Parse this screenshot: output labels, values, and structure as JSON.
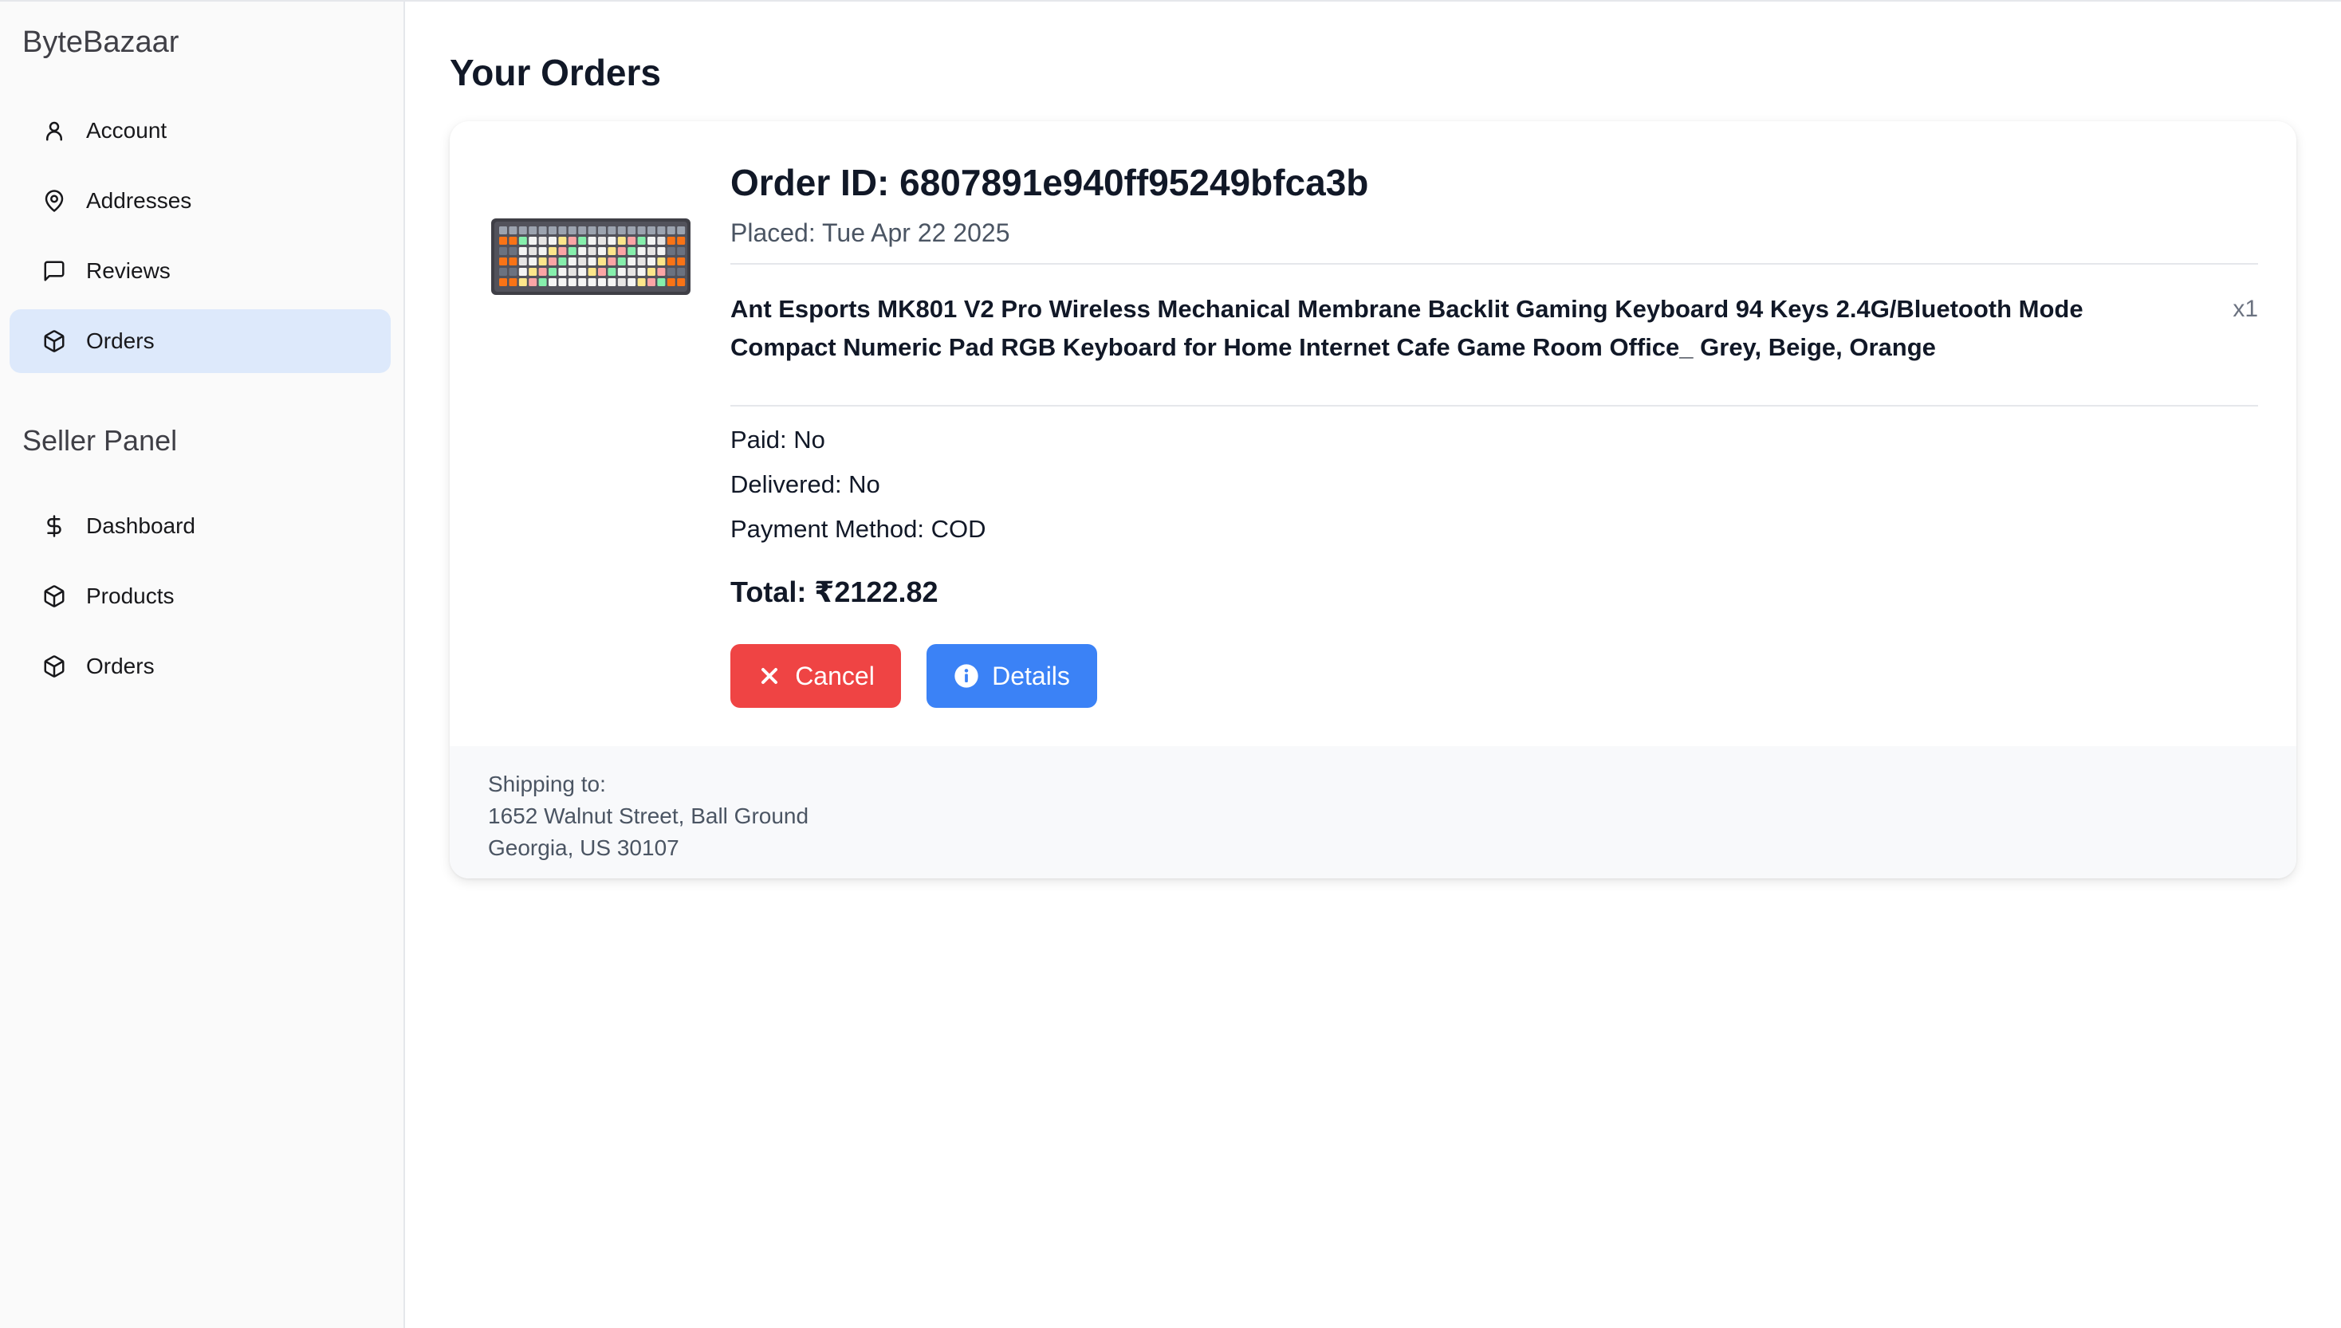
{
  "brand": "ByteBazaar",
  "sidebar": {
    "user_items": [
      {
        "label": "Account",
        "icon": "user-icon"
      },
      {
        "label": "Addresses",
        "icon": "map-pin-icon"
      },
      {
        "label": "Reviews",
        "icon": "message-square-icon"
      },
      {
        "label": "Orders",
        "icon": "package-icon",
        "active": true
      }
    ],
    "seller_title": "Seller Panel",
    "seller_items": [
      {
        "label": "Dashboard",
        "icon": "dollar-sign-icon"
      },
      {
        "label": "Products",
        "icon": "package-icon"
      },
      {
        "label": "Orders",
        "icon": "package-icon"
      }
    ]
  },
  "main": {
    "title": "Your Orders",
    "order": {
      "order_id": "Order ID: 6807891e940ff95249bfca3b",
      "placed": "Placed: Tue Apr 22 2025",
      "item": {
        "name": "Ant Esports MK801 V2 Pro Wireless Mechanical Membrane Backlit Gaming Keyboard 94 Keys 2.4G/Bluetooth Mode Compact Numeric Pad RGB Keyboard for Home Internet Cafe Game Room Office_ Grey, Beige, Orange",
        "qty": "x1",
        "image": "keyboard-product-image"
      },
      "paid": "Paid: No",
      "delivered": "Delivered: No",
      "payment_method": "Payment Method: COD",
      "total": "Total: ₹2122.82",
      "cancel_label": "Cancel",
      "details_label": "Details",
      "shipping": {
        "label": "Shipping to:",
        "line1": "1652 Walnut Street, Ball Ground",
        "line2": "Georgia, US 30107"
      }
    }
  },
  "colors": {
    "active_nav_bg": "#dde9fb",
    "cancel": "#ef4444",
    "details": "#3b82f6"
  }
}
